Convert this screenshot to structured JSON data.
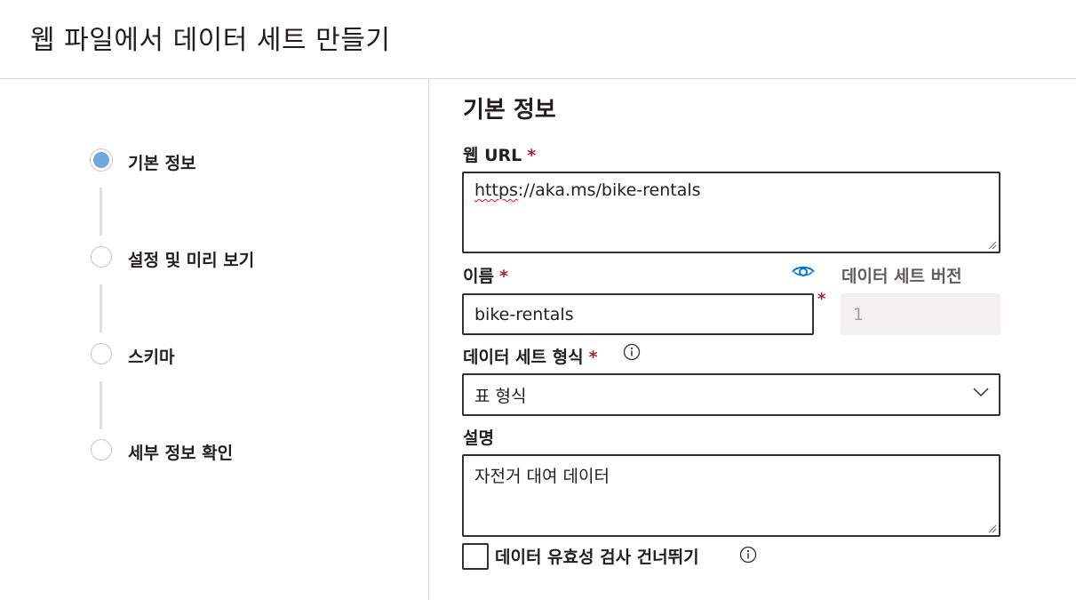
{
  "header": {
    "title": "웹 파일에서 데이터 세트 만들기"
  },
  "steps": [
    {
      "label": "기본 정보",
      "state": "active"
    },
    {
      "label": "설정 및 미리 보기",
      "state": "pending"
    },
    {
      "label": "스키마",
      "state": "pending"
    },
    {
      "label": "세부 정보 확인",
      "state": "pending"
    }
  ],
  "form": {
    "section_title": "기본 정보",
    "web_url": {
      "label": "웹 URL",
      "required": "*",
      "value_prefix": "https",
      "value_rest": "://aka.ms/bike-rentals"
    },
    "name": {
      "label": "이름",
      "required": "*",
      "value": "bike-rentals",
      "icon": "eye-icon"
    },
    "version": {
      "label": "데이터 세트 버전",
      "required": "*",
      "value": "1"
    },
    "dataset_type": {
      "label": "데이터 세트 형식",
      "required": "*",
      "value": "표 형식",
      "icon": "info-icon"
    },
    "description": {
      "label": "설명",
      "value": "자전거 대여 데이터"
    },
    "skip_validation": {
      "label": "데이터 유효성 검사 건너뛰기",
      "checked": false,
      "icon": "info-icon"
    }
  },
  "colors": {
    "accent": "#0078d4",
    "required": "#a4262c",
    "active_step": "#6fa7de"
  }
}
